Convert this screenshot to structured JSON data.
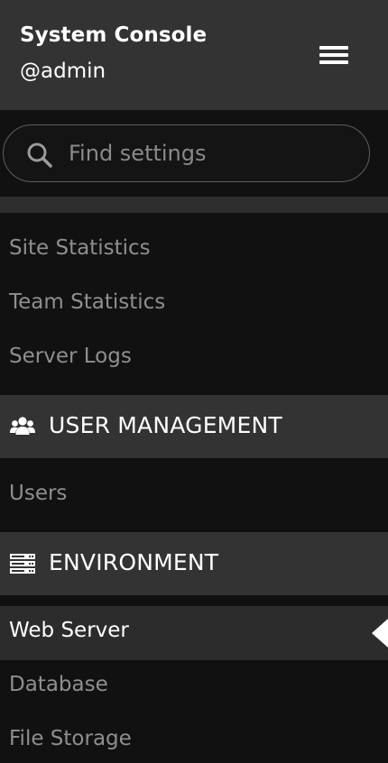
{
  "header": {
    "title": "System Console",
    "username": "@admin",
    "menu_icon": "hamburger-menu-icon"
  },
  "search": {
    "placeholder": "Find settings",
    "value": "",
    "icon": "search-icon"
  },
  "reporting": {
    "items": [
      {
        "label": "Site Statistics"
      },
      {
        "label": "Team Statistics"
      },
      {
        "label": "Server Logs"
      }
    ]
  },
  "user_management": {
    "title": "USER MANAGEMENT",
    "icon": "users-icon",
    "items": [
      {
        "label": "Users"
      }
    ]
  },
  "environment": {
    "title": "ENVIRONMENT",
    "icon": "server-icon",
    "items": [
      {
        "label": "Web Server",
        "active": true
      },
      {
        "label": "Database"
      },
      {
        "label": "File Storage"
      }
    ]
  },
  "colors": {
    "background": "#111111",
    "header_background": "#333333",
    "section_background": "#333333",
    "active_background": "#2c2c2c",
    "text_primary": "#ffffff",
    "text_muted": "#8f8f8f"
  }
}
